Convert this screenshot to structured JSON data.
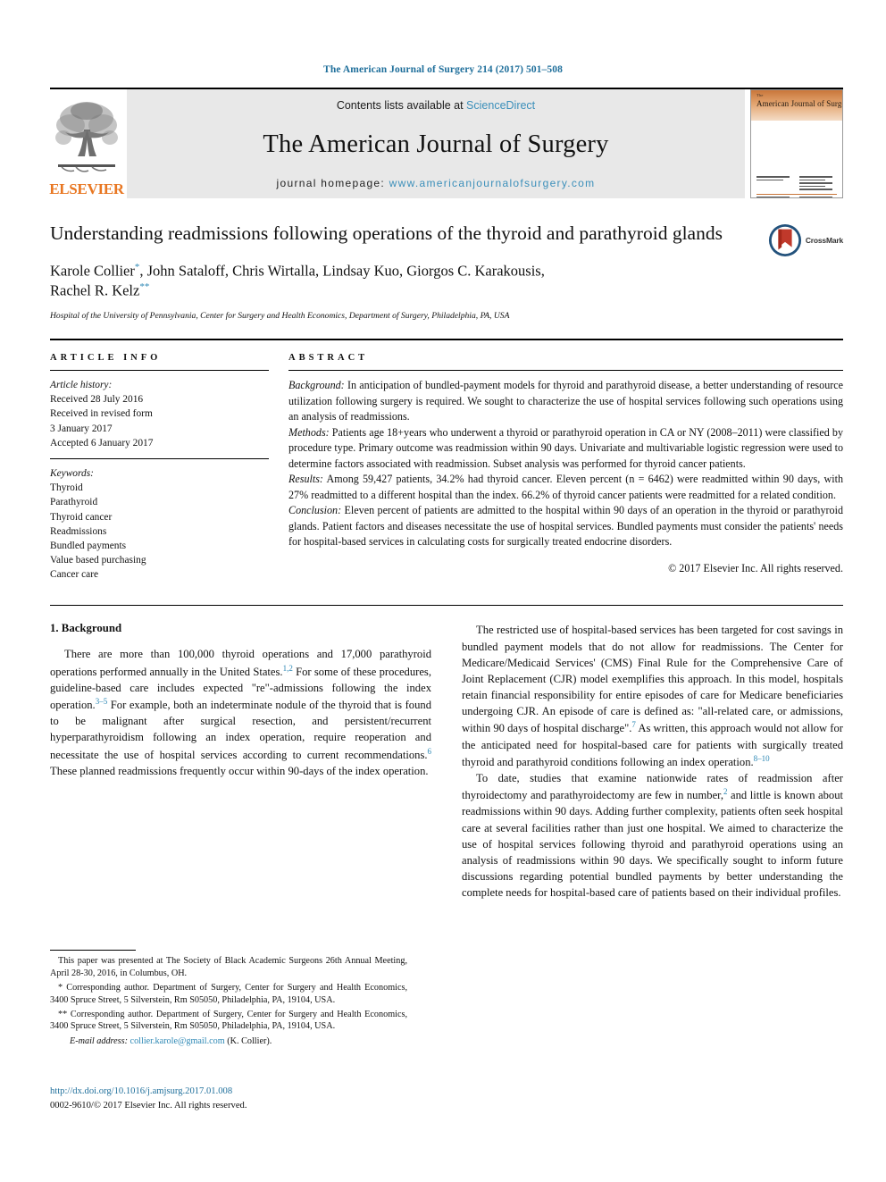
{
  "running_head": "The American Journal of Surgery 214 (2017) 501–508",
  "masthead": {
    "publisher_name": "ELSEVIER",
    "contents_prefix": "Contents lists available at ",
    "contents_link": "ScienceDirect",
    "journal_name": "The American Journal of Surgery",
    "homepage_prefix": "journal homepage: ",
    "homepage_url": "www.americanjournalofsurgery.com",
    "cover": {
      "the": "The",
      "title": "American Journal of Surgery"
    }
  },
  "article": {
    "title": "Understanding readmissions following operations of the thyroid and parathyroid glands",
    "crossmark_label": "CrossMark",
    "authors_line1_pre": "Karole Collier",
    "authors_line1_sup": "*",
    "authors_line1_post": ", John Sataloff, Chris Wirtalla, Lindsay Kuo, Giorgos C. Karakousis,",
    "authors_line2_pre": "Rachel R. Kelz",
    "authors_line2_sup": "**",
    "affiliation": "Hospital of the University of Pennsylvania, Center for Surgery and Health Economics, Department of Surgery, Philadelphia, PA, USA"
  },
  "article_info": {
    "heading": "ARTICLE INFO",
    "history_label": "Article history:",
    "history": [
      "Received 28 July 2016",
      "Received in revised form",
      "3 January 2017",
      "Accepted 6 January 2017"
    ],
    "keywords_label": "Keywords:",
    "keywords": [
      "Thyroid",
      "Parathyroid",
      "Thyroid cancer",
      "Readmissions",
      "Bundled payments",
      "Value based purchasing",
      "Cancer care"
    ]
  },
  "abstract": {
    "heading": "ABSTRACT",
    "sections": [
      {
        "label": "Background:",
        "text": " In anticipation of bundled-payment models for thyroid and parathyroid disease, a better understanding of resource utilization following surgery is required. We sought to characterize the use of hospital services following such operations using an analysis of readmissions."
      },
      {
        "label": "Methods:",
        "text": " Patients age 18+years who underwent a thyroid or parathyroid operation in CA or NY (2008–2011) were classified by procedure type. Primary outcome was readmission within 90 days. Univariate and multivariable logistic regression were used to determine factors associated with readmission. Subset analysis was performed for thyroid cancer patients."
      },
      {
        "label": "Results:",
        "text": " Among 59,427 patients, 34.2% had thyroid cancer. Eleven percent (n = 6462) were readmitted within 90 days, with 27% readmitted to a different hospital than the index. 66.2% of thyroid cancer patients were readmitted for a related condition."
      },
      {
        "label": "Conclusion:",
        "text": " Eleven percent of patients are admitted to the hospital within 90 days of an operation in the thyroid or parathyroid glands. Patient factors and diseases necessitate the use of hospital services. Bundled payments must consider the patients' needs for hospital-based services in calculating costs for surgically treated endocrine disorders."
      }
    ],
    "copyright": "© 2017 Elsevier Inc. All rights reserved."
  },
  "body": {
    "section_heading": "1. Background",
    "left_paragraphs": [
      {
        "parts": [
          {
            "t": "There are more than 100,000 thyroid operations and 17,000 parathyroid operations performed annually in the United States."
          },
          {
            "ref": "1,2"
          },
          {
            "t": " For some of these procedures, guideline-based care includes expected \"re\"-admissions following the index operation."
          },
          {
            "ref": "3–5"
          },
          {
            "t": " For example, both an indeterminate nodule of the thyroid that is found to be malignant after surgical resection, and persistent/recurrent hyperparathyroidism following an index operation, require reoperation and necessitate the use of hospital services according to current recommendations."
          },
          {
            "ref": "6"
          },
          {
            "t": " These planned readmissions frequently occur within 90-days of the index operation."
          }
        ]
      }
    ],
    "right_paragraphs": [
      {
        "parts": [
          {
            "t": "The restricted use of hospital-based services has been targeted for cost savings in bundled payment models that do not allow for readmissions. The Center for Medicare/Medicaid Services' (CMS) Final Rule for the Comprehensive Care of Joint Replacement (CJR) model exemplifies this approach. In this model, hospitals retain financial responsibility for entire episodes of care for Medicare beneficiaries undergoing CJR. An episode of care is defined as: \"all-related care, or admissions, within 90 days of hospital discharge\"."
          },
          {
            "ref": "7"
          },
          {
            "t": " As written, this approach would not allow for the anticipated need for hospital-based care for patients with surgically treated thyroid and parathyroid conditions following an index operation."
          },
          {
            "ref": "8–10"
          }
        ]
      },
      {
        "parts": [
          {
            "t": "To date, studies that examine nationwide rates of readmission after thyroidectomy and parathyroidectomy are few in number,"
          },
          {
            "ref": "2"
          },
          {
            "t": " and little is known about readmissions within 90 days. Adding further complexity, patients often seek hospital care at several facilities rather than just one hospital. We aimed to characterize the use of hospital services following thyroid and parathyroid operations using an analysis of readmissions within 90 days. We specifically sought to inform future discussions regarding potential bundled payments by better understanding the complete needs for hospital-based care of patients based on their individual profiles."
          }
        ]
      }
    ]
  },
  "footnotes": [
    "This paper was presented at The Society of Black Academic Surgeons 26th Annual Meeting, April 28-30, 2016, in Columbus, OH.",
    "* Corresponding author. Department of Surgery, Center for Surgery and Health Economics, 3400 Spruce Street, 5 Silverstein, Rm S05050, Philadelphia, PA, 19104, USA.",
    "** Corresponding author. Department of Surgery, Center for Surgery and Health Economics, 3400 Spruce Street, 5 Silverstein, Rm S05050, Philadelphia, PA, 19104, USA."
  ],
  "email_note": {
    "label": "E-mail address:",
    "address": "collier.karole@gmail.com",
    "suffix": "(K. Collier)."
  },
  "doi": {
    "url": "http://dx.doi.org/10.1016/j.amjsurg.2017.01.008",
    "issn_line": "0002-9610/© 2017 Elsevier Inc. All rights reserved."
  },
  "colors": {
    "link": "#2d88b5",
    "running_head": "#1f6f9b",
    "elsevier_orange": "#e87722",
    "band_gray": "#e8e8e8"
  }
}
